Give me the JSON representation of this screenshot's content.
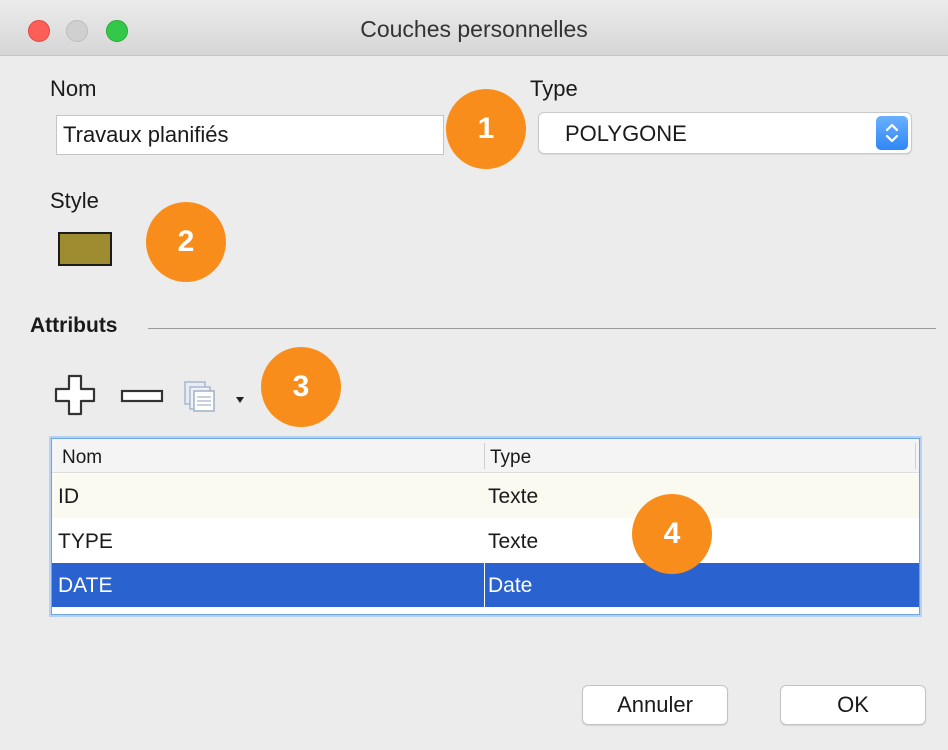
{
  "window": {
    "title": "Couches personnelles"
  },
  "form": {
    "name_label": "Nom",
    "name_value": "Travaux planifiés",
    "type_label": "Type",
    "type_value": "POLYGONE",
    "style_label": "Style",
    "style_color": "#9f8c30"
  },
  "badges": [
    "1",
    "2",
    "3",
    "4"
  ],
  "attributes": {
    "section_title": "Attributs",
    "toolbar": {
      "add_icon": "plus-icon",
      "remove_icon": "minus-icon",
      "copy_icon": "copy-icon",
      "dropdown_icon": "dropdown-arrow-icon"
    },
    "columns": [
      "Nom",
      "Type"
    ],
    "rows": [
      {
        "name": "ID",
        "type": "Texte"
      },
      {
        "name": "TYPE",
        "type": "Texte"
      },
      {
        "name": "DATE",
        "type": "Date",
        "selected": true
      }
    ]
  },
  "buttons": {
    "cancel": "Annuler",
    "ok": "OK"
  },
  "colors": {
    "badge": "#f98d1c",
    "selection": "#2a62cf",
    "select_arrow": "#2f86f5"
  }
}
